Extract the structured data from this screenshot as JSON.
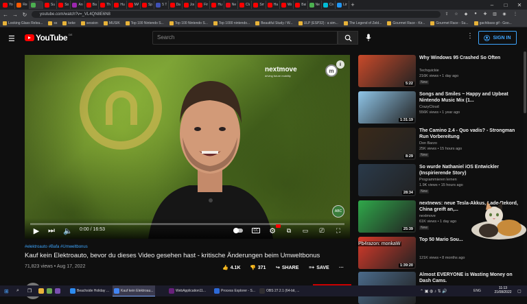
{
  "browser": {
    "tabs": [
      "You",
      "Reci",
      "",
      "Sure",
      "So b",
      "Ann",
      "Batt",
      "This",
      "Hug",
      "MAI",
      "Spin",
      "5 Th",
      "Dat",
      "Jony",
      "Fine",
      "Hug",
      "Netf",
      "Clau",
      "Sma",
      "Hal",
      "War",
      "Batt",
      "New",
      "Crea",
      "Lino"
    ],
    "url": "youtube.com/watch?v=_VL4QN8E6N8",
    "bookmarks": [
      "Looking Glass Relea...",
      "ss",
      "keke",
      "session",
      "MUSIK",
      "Top 100 Nintendo S...",
      "Top 100 Nintendo S...",
      "Top 1000 nintendo...",
      "Beautiful Study / W...",
      "ULP (ESP32) : a sim...",
      "The Legend of Zeld...",
      "Gourmet Race - Kir...",
      "Gourmet Race - Su...",
      "gachibass gif - Goo..."
    ]
  },
  "header": {
    "logo_text": "YouTube",
    "country_code": "DE",
    "search_placeholder": "Search",
    "signin_label": "SIGN IN",
    "menu_icon": "hamburger-icon",
    "kebab": "⋮"
  },
  "video": {
    "brand": "nextmove",
    "brand_sub": "driving future mobility",
    "brand_logo": "m",
    "info": "i",
    "abc_badge": "ABC",
    "time": "0:00 / 16:53",
    "progress": 0.0,
    "hashtags": "#elektroauto #Bafa #Umweltbonus",
    "title": "Kauf kein Elektroauto, bevor du dieses Video gesehen hast - kritische Änderungen beim Umweltbonus",
    "views_date": "71,823 views • Aug 17, 2022",
    "likes": "4.1K",
    "dislikes": "371",
    "share": "SHARE",
    "save": "SAVE",
    "more": "···"
  },
  "sidebar": [
    {
      "title": "Why Windows 95 Crashed So Often",
      "channel": "Techquickie",
      "views": "216K views • 1 day ago",
      "badge": "New",
      "duration": "5:22",
      "color": "#c94a2a"
    },
    {
      "title": "Songs and Smiles ~ Happy and Upbeat Nintendo Music Mix (1...",
      "channel": "CrazyCloud",
      "views": "556K views • 1 year ago",
      "badge": "",
      "duration": "1:31:19",
      "color": "#8fc5e8"
    },
    {
      "title": "The Camino 2.4 - Quo vadis? - Strongman Run Vorbereitung",
      "channel": "Don Barzo",
      "views": "25K views • 15 hours ago",
      "badge": "New",
      "duration": "8:29",
      "color": "#3a2a1a"
    },
    {
      "title": "So wurde Nathaniel iOS Entwickler (Inspirierende Story)",
      "channel": "Programmieren lernen",
      "views": "1.9K views • 15 hours ago",
      "badge": "New",
      "duration": "28:34",
      "color": "#2a3a4a"
    },
    {
      "title": "nextnews: neue Tesla-Akkus, Lade-Rekord, China greift an,...",
      "channel": "nextmove",
      "views": "61K views • 1 day ago",
      "badge": "New",
      "duration": "25:39",
      "color": "#2fa84a"
    },
    {
      "title": "Top 50 Mario Sou...",
      "channel": "",
      "views": "121K views • 8 months ago",
      "badge": "",
      "duration": "1:39:20",
      "color": "#d83a2a"
    },
    {
      "title": "Almost EVERYONE is Wasting Money on Dash Cams.",
      "channel": "",
      "views": "",
      "badge": "",
      "duration": "",
      "color": "#4a6a8a"
    }
  ],
  "overlay": {
    "chat_name": "Pb4razon: monkaW"
  },
  "taskbar": {
    "items": [
      "Beachside Holiday ...",
      "Kauf kein Elektroau...",
      "WebApplication11...",
      "Process Explorer - S...",
      "OBS 27.2.1 (64-bit, ..."
    ],
    "lang": "ENG",
    "time": "11:13",
    "date": "21/08/2022"
  }
}
